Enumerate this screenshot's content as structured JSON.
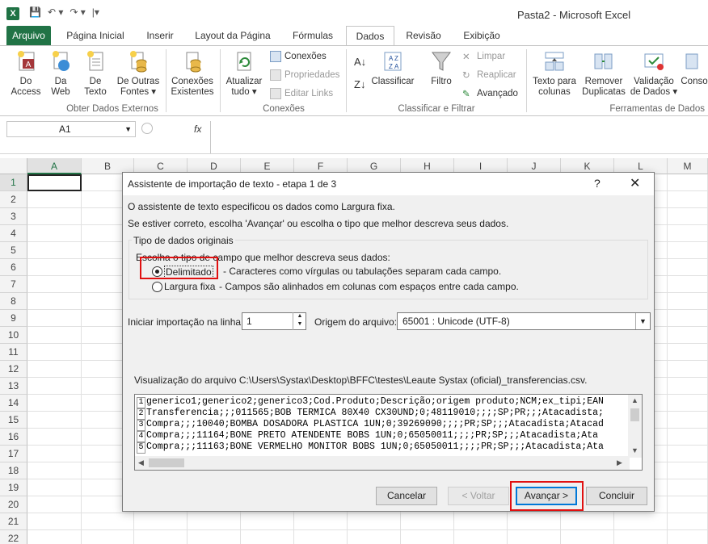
{
  "window": {
    "title": "Pasta2  -  Microsoft Excel",
    "logo": "X"
  },
  "tabs": [
    "Arquivo",
    "Página Inicial",
    "Inserir",
    "Layout da Página",
    "Fórmulas",
    "Dados",
    "Revisão",
    "Exibição"
  ],
  "active_tab": "Dados",
  "ribbon": {
    "external": {
      "label": "Obter Dados Externos",
      "access": [
        "Do",
        "Access"
      ],
      "web": [
        "Da",
        "Web"
      ],
      "text": [
        "De",
        "Texto"
      ],
      "other": [
        "De Outras",
        "Fontes ▾"
      ],
      "existing": [
        "Conexões",
        "Existentes"
      ]
    },
    "connections": {
      "label": "Conexões",
      "refresh": [
        "Atualizar",
        "tudo ▾"
      ],
      "conn": "Conexões",
      "props": "Propriedades",
      "edit_links": "Editar Links"
    },
    "sort": {
      "label": "Classificar e Filtrar",
      "sort": "Classificar",
      "filter": "Filtro",
      "clear": "Limpar",
      "reapply": "Reaplicar",
      "advanced": "Avançado"
    },
    "tools": {
      "label": "Ferramentas de Dados",
      "text_cols": [
        "Texto para",
        "colunas"
      ],
      "remove_dup": [
        "Remover",
        "Duplicatas"
      ],
      "validation": [
        "Validação",
        "de Dados ▾"
      ],
      "cons": "Conso"
    }
  },
  "formula_bar": {
    "name_box": "A1",
    "fx": "fx"
  },
  "columns": [
    "A",
    "B",
    "C",
    "D",
    "E",
    "F",
    "G",
    "H",
    "I",
    "J",
    "K",
    "L",
    "M"
  ],
  "rows": [
    "1",
    "2",
    "3",
    "4",
    "5",
    "6",
    "7",
    "8",
    "9",
    "10",
    "11",
    "12",
    "13",
    "14",
    "15",
    "16",
    "17",
    "18",
    "19",
    "20",
    "21",
    "22"
  ],
  "dialog": {
    "title": "Assistente de importação de texto - etapa 1 de 3",
    "help": "?",
    "close": "✕",
    "line1": "O assistente de texto especificou os dados como Largura fixa.",
    "line2": "Se estiver correto, escolha 'Avançar' ou escolha o tipo que melhor descreva seus dados.",
    "group_title": "Tipo de dados originais",
    "choose_label": "Escolha o tipo de campo que melhor descreva seus dados:",
    "delimited_label": "Delimitado",
    "delimited_desc": "- Caracteres como vírgulas ou tabulações separam cada campo.",
    "fixed_label": "Largura fixa",
    "fixed_desc": "- Campos são alinhados em colunas com espaços entre cada campo.",
    "start_row_label": "Iniciar importação na linha:",
    "start_row_value": "1",
    "origin_label": "Origem do arquivo:",
    "origin_value": "65001 : Unicode (UTF-8)",
    "preview_label": "Visualização do arquivo C:\\Users\\Systax\\Desktop\\BFFC\\testes\\Leaute Systax (oficial)_transferencias.csv.",
    "preview_lines": [
      {
        "n": "1",
        "text": "generico1;generico2;generico3;Cod.Produto;Descrição;origem produto;NCM;ex_tipi;EAN"
      },
      {
        "n": "2",
        "text": "Transferencia;;;011565;BOB TERMICA 80X40 CX30UND;0;48119010;;;;SP;PR;;;Atacadista;"
      },
      {
        "n": "3",
        "text": "Compra;;;10040;BOMBA DOSADORA PLASTICA 1UN;0;39269090;;;;PR;SP;;;Atacadista;Atacad"
      },
      {
        "n": "4",
        "text": "Compra;;;11164;BONE PRETO ATENDENTE  BOBS 1UN;0;65050011;;;;PR;SP;;;Atacadista;Ata"
      },
      {
        "n": "5",
        "text": "Compra;;;11163;BONE VERMELHO MONITOR BOBS 1UN;0;65050011;;;;PR;SP;;;Atacadista;Ata"
      }
    ],
    "buttons": {
      "cancel": "Cancelar",
      "back": "< Voltar",
      "next": "Avançar >",
      "finish": "Concluir"
    }
  },
  "colors": {
    "excel_green": "#217346",
    "highlight_red": "#e01010",
    "focus_blue": "#0078d7"
  }
}
